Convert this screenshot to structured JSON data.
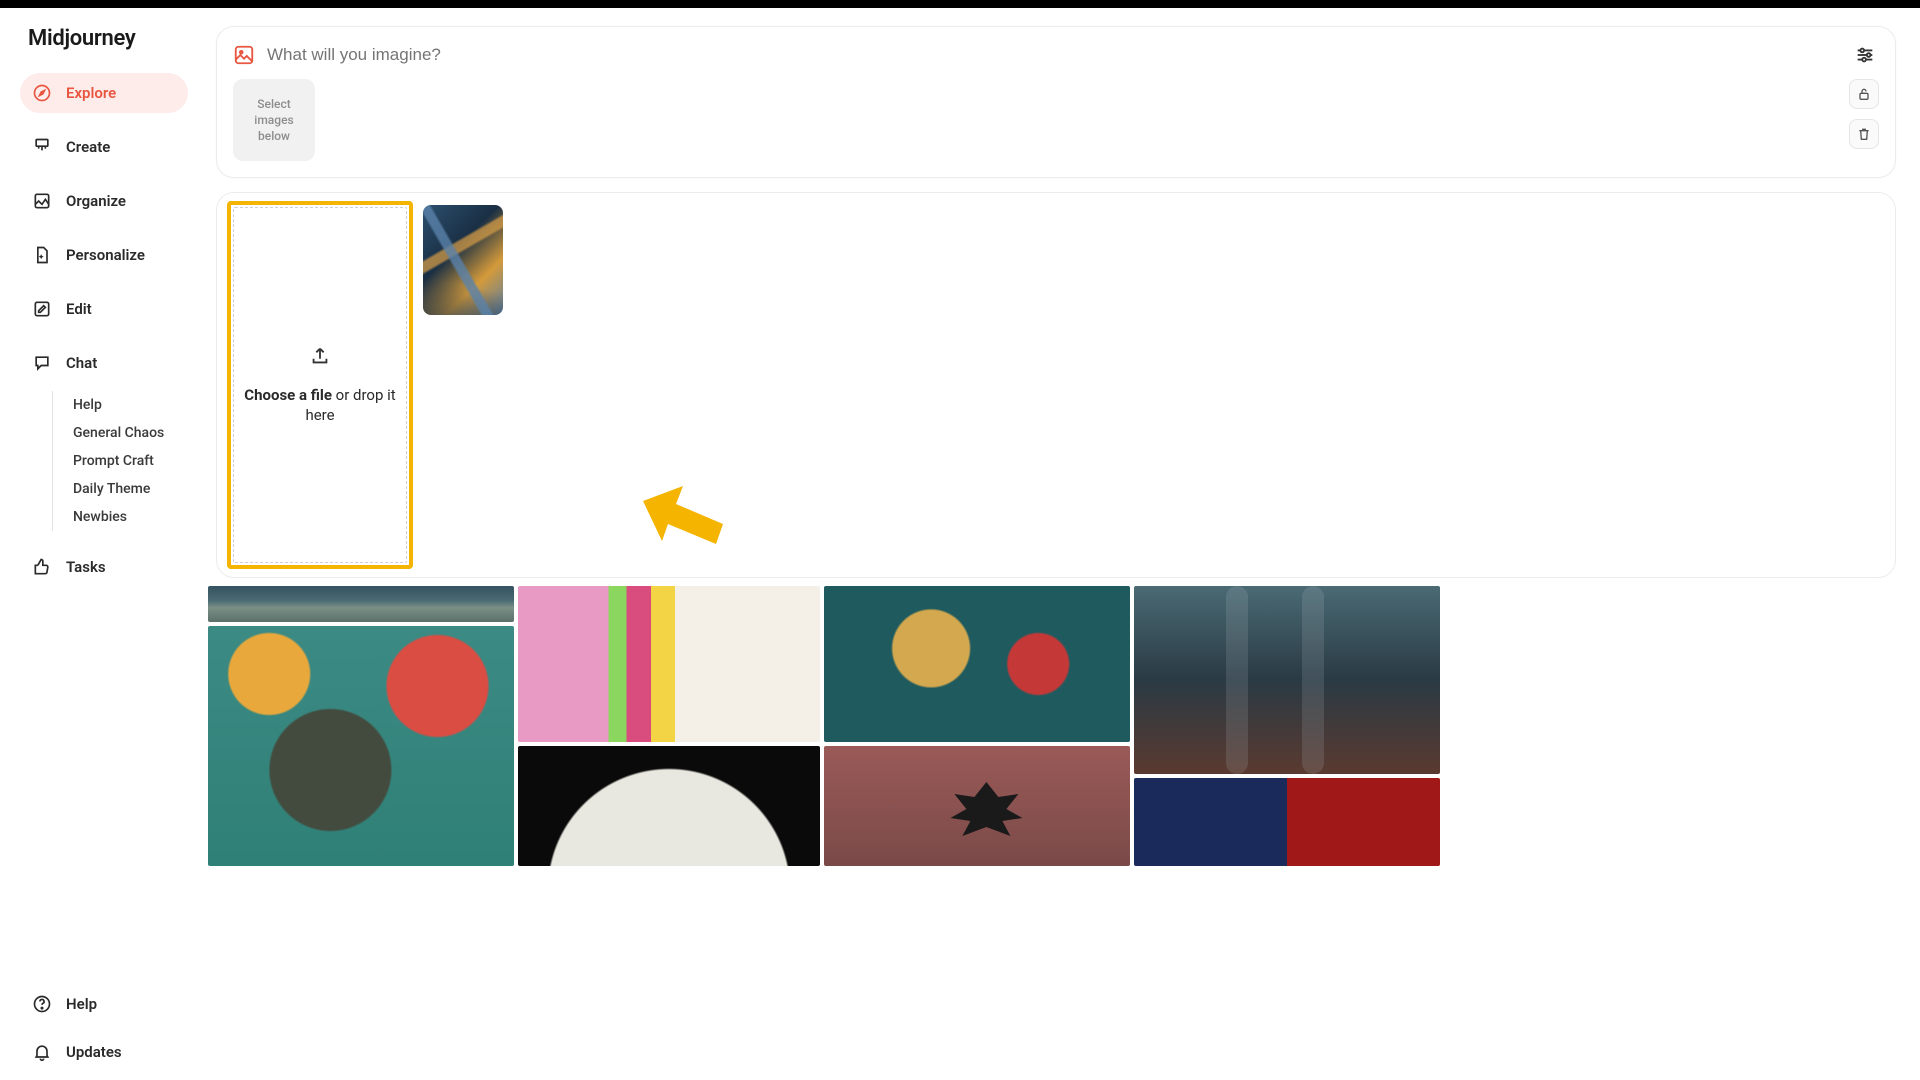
{
  "brand": "Midjourney",
  "nav": {
    "explore": "Explore",
    "create": "Create",
    "organize": "Organize",
    "personalize": "Personalize",
    "edit": "Edit",
    "chat": "Chat",
    "tasks": "Tasks"
  },
  "chat_sub": {
    "help": "Help",
    "general_chaos": "General Chaos",
    "prompt_craft": "Prompt Craft",
    "daily_theme": "Daily Theme",
    "newbies": "Newbies"
  },
  "footer_nav": {
    "help": "Help",
    "updates": "Updates"
  },
  "prompt": {
    "placeholder": "What will you imagine?",
    "select_tile": "Select images below"
  },
  "upload": {
    "choose_bold": "Choose a file",
    "choose_rest": " or drop it here"
  }
}
